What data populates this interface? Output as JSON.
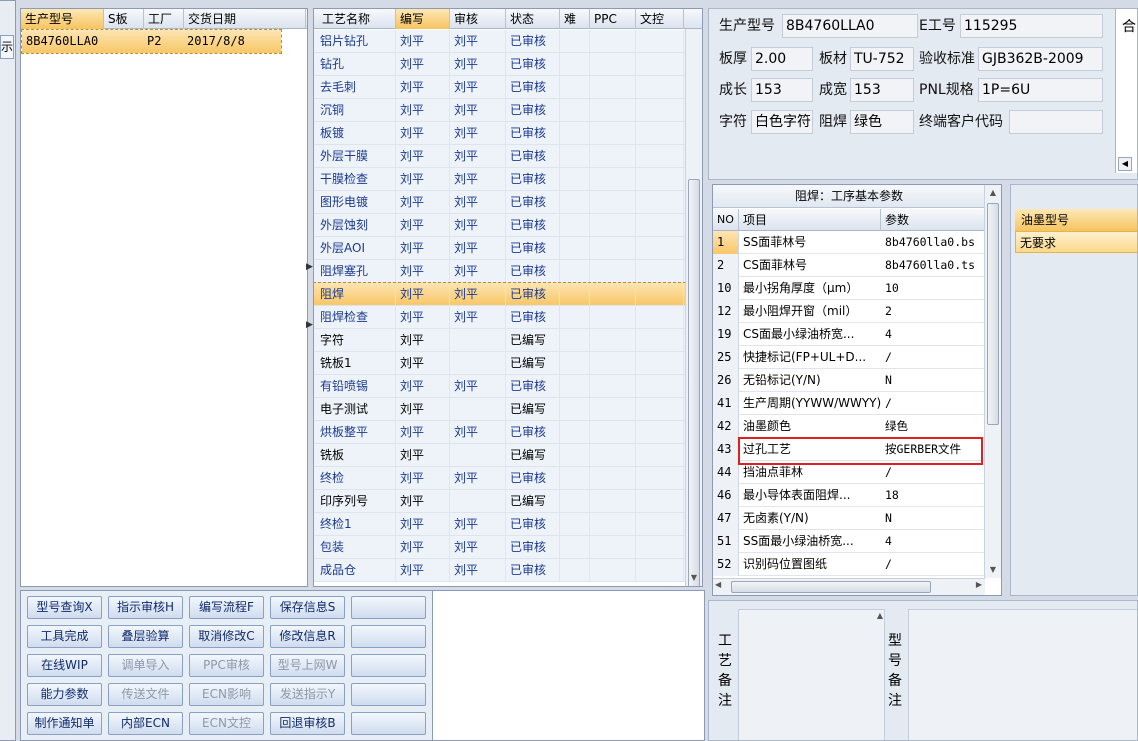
{
  "left_edge": {
    "label": "示"
  },
  "model_list": {
    "headers": [
      "生产型号",
      "S板",
      "工厂",
      "交货日期"
    ],
    "rows": [
      {
        "model": "8B4760LLA0",
        "s": "",
        "factory": "P2",
        "date": "2017/8/8"
      }
    ]
  },
  "process_list": {
    "headers": [
      "工艺名称",
      "编写",
      "审核",
      "状态",
      "难",
      "PPC",
      "文控"
    ],
    "rows": [
      {
        "name": "铝片钻孔",
        "writer": "刘平",
        "reviewer": "刘平",
        "status": "已审核",
        "blue": true
      },
      {
        "name": "钻孔",
        "writer": "刘平",
        "reviewer": "刘平",
        "status": "已审核",
        "blue": true
      },
      {
        "name": "去毛刺",
        "writer": "刘平",
        "reviewer": "刘平",
        "status": "已审核",
        "blue": true
      },
      {
        "name": "沉铜",
        "writer": "刘平",
        "reviewer": "刘平",
        "status": "已审核",
        "blue": true
      },
      {
        "name": "板镀",
        "writer": "刘平",
        "reviewer": "刘平",
        "status": "已审核",
        "blue": true
      },
      {
        "name": "外层干膜",
        "writer": "刘平",
        "reviewer": "刘平",
        "status": "已审核",
        "blue": true
      },
      {
        "name": "干膜检查",
        "writer": "刘平",
        "reviewer": "刘平",
        "status": "已审核",
        "blue": true
      },
      {
        "name": "图形电镀",
        "writer": "刘平",
        "reviewer": "刘平",
        "status": "已审核",
        "blue": true
      },
      {
        "name": "外层蚀刻",
        "writer": "刘平",
        "reviewer": "刘平",
        "status": "已审核",
        "blue": true
      },
      {
        "name": "外层AOI",
        "writer": "刘平",
        "reviewer": "刘平",
        "status": "已审核",
        "blue": true
      },
      {
        "name": "阻焊塞孔",
        "writer": "刘平",
        "reviewer": "刘平",
        "status": "已审核",
        "blue": true
      },
      {
        "name": "阻焊",
        "writer": "刘平",
        "reviewer": "刘平",
        "status": "已审核",
        "blue": true,
        "selected": true
      },
      {
        "name": "阻焊检查",
        "writer": "刘平",
        "reviewer": "刘平",
        "status": "已审核",
        "blue": true
      },
      {
        "name": "字符",
        "writer": "刘平",
        "reviewer": "",
        "status": "已编写",
        "blue": false
      },
      {
        "name": "铣板1",
        "writer": "刘平",
        "reviewer": "",
        "status": "已编写",
        "blue": false
      },
      {
        "name": "有铅喷锡",
        "writer": "刘平",
        "reviewer": "刘平",
        "status": "已审核",
        "blue": true
      },
      {
        "name": "电子测试",
        "writer": "刘平",
        "reviewer": "",
        "status": "已编写",
        "blue": false
      },
      {
        "name": "烘板整平",
        "writer": "刘平",
        "reviewer": "刘平",
        "status": "已审核",
        "blue": true
      },
      {
        "name": "铣板",
        "writer": "刘平",
        "reviewer": "",
        "status": "已编写",
        "blue": false
      },
      {
        "name": "终检",
        "writer": "刘平",
        "reviewer": "刘平",
        "status": "已审核",
        "blue": true
      },
      {
        "name": "印序列号",
        "writer": "刘平",
        "reviewer": "",
        "status": "已编写",
        "blue": false
      },
      {
        "name": "终检1",
        "writer": "刘平",
        "reviewer": "刘平",
        "status": "已审核",
        "blue": true
      },
      {
        "name": "包装",
        "writer": "刘平",
        "reviewer": "刘平",
        "status": "已审核",
        "blue": true
      },
      {
        "name": "成品仓",
        "writer": "刘平",
        "reviewer": "刘平",
        "status": "已审核",
        "blue": true
      }
    ]
  },
  "buttons": [
    [
      {
        "label": "型号查询X",
        "disabled": false
      },
      {
        "label": "指示审核H",
        "disabled": false
      },
      {
        "label": "编写流程F",
        "disabled": false
      },
      {
        "label": "保存信息S",
        "disabled": false
      },
      {
        "label": "",
        "disabled": false
      }
    ],
    [
      {
        "label": "工具完成",
        "disabled": false
      },
      {
        "label": "叠层验算",
        "disabled": false
      },
      {
        "label": "取消修改C",
        "disabled": false
      },
      {
        "label": "修改信息R",
        "disabled": false
      },
      {
        "label": "",
        "disabled": false
      }
    ],
    [
      {
        "label": "在线WIP",
        "disabled": false
      },
      {
        "label": "调单导入",
        "disabled": true
      },
      {
        "label": "PPC审核",
        "disabled": true
      },
      {
        "label": "型号上网W",
        "disabled": true
      },
      {
        "label": "",
        "disabled": false
      }
    ],
    [
      {
        "label": "能力参数",
        "disabled": false
      },
      {
        "label": "传送文件",
        "disabled": true
      },
      {
        "label": "ECN影响",
        "disabled": true
      },
      {
        "label": "发送指示Y",
        "disabled": true
      },
      {
        "label": "",
        "disabled": false
      }
    ],
    [
      {
        "label": "制作通知单",
        "disabled": false
      },
      {
        "label": "内部ECN",
        "disabled": false
      },
      {
        "label": "ECN文控",
        "disabled": true
      },
      {
        "label": "回退审核B",
        "disabled": false
      },
      {
        "label": "",
        "disabled": false
      }
    ]
  ],
  "info": {
    "model_label": "生产型号",
    "model_value": "8B4760LLA0",
    "eno_label": "E工号",
    "eno_value": "115295",
    "thick_label": "板厚",
    "thick_value": "2.00",
    "material_label": "板材",
    "material_value": "TU-752",
    "std_label": "验收标准",
    "std_value": "GJB362B-2009",
    "len_label": "成长",
    "len_value": "153",
    "wid_label": "成宽",
    "wid_value": "153",
    "pnl_label": "PNL规格",
    "pnl_value": "1P=6U",
    "char_label": "字符",
    "char_value": "白色字符",
    "mask_label": "阻焊",
    "mask_value": "绿色",
    "cust_label": "终端客户代码",
    "cust_value": "",
    "merge_label": "合"
  },
  "params": {
    "title": "阻焊：工序基本参数",
    "headers": [
      "NO",
      "项目",
      "参数"
    ],
    "rows": [
      {
        "no": "1",
        "item": "SS面菲林号",
        "value": "8b4760lla0.bs"
      },
      {
        "no": "2",
        "item": "CS面菲林号",
        "value": "8b4760lla0.ts"
      },
      {
        "no": "10",
        "item": "最小拐角厚度（μm）",
        "value": "10"
      },
      {
        "no": "12",
        "item": "最小阻焊开窗（mil）",
        "value": "2"
      },
      {
        "no": "19",
        "item": "CS面最小绿油桥宽...",
        "value": "4"
      },
      {
        "no": "25",
        "item": "快捷标记(FP+UL+D...",
        "value": "/"
      },
      {
        "no": "26",
        "item": "无铅标记(Y/N)",
        "value": "N"
      },
      {
        "no": "41",
        "item": "生产周期(YYWW/WWYY)",
        "value": "/"
      },
      {
        "no": "42",
        "item": "油墨颜色",
        "value": "绿色"
      },
      {
        "no": "43",
        "item": "过孔工艺",
        "value": "按GERBER文件"
      },
      {
        "no": "44",
        "item": "挡油点菲林",
        "value": "/"
      },
      {
        "no": "46",
        "item": "最小导体表面阻焊...",
        "value": "18"
      },
      {
        "no": "47",
        "item": "无卤素(Y/N)",
        "value": "N"
      },
      {
        "no": "51",
        "item": "SS面最小绿油桥宽...",
        "value": "4"
      },
      {
        "no": "52",
        "item": "识别码位置图纸",
        "value": "/"
      }
    ]
  },
  "ink": {
    "header": "油墨型号",
    "value": "无要求"
  },
  "notes": {
    "process_label": "工艺备注",
    "model_label": "型号备注"
  },
  "colors": {
    "highlight": "#f8c767",
    "blue_text": "#1b3a8f",
    "red_box": "#e02020"
  }
}
